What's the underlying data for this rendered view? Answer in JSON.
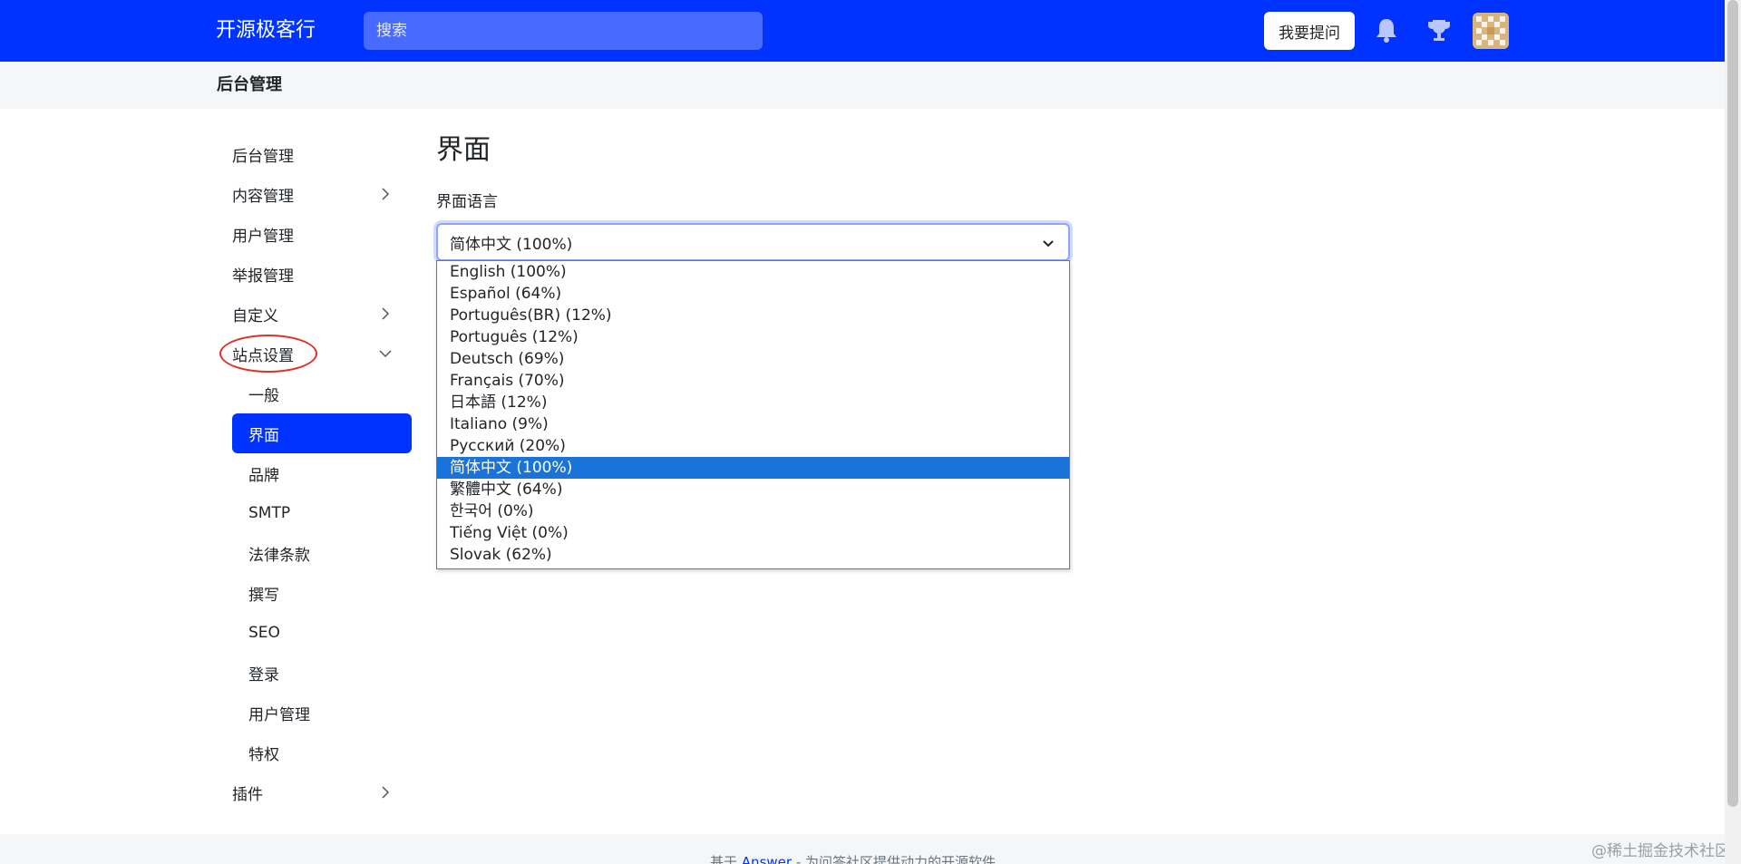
{
  "header": {
    "brand": "开源极客行",
    "search_placeholder": "搜索",
    "ask_button": "我要提问",
    "icons": [
      "bell-icon",
      "trophy-icon",
      "avatar"
    ]
  },
  "subheader": {
    "title": "后台管理"
  },
  "sidebar": {
    "items": [
      {
        "label": "后台管理",
        "level": 0,
        "chevron": "none"
      },
      {
        "label": "内容管理",
        "level": 0,
        "chevron": "right"
      },
      {
        "label": "用户管理",
        "level": 0,
        "chevron": "none"
      },
      {
        "label": "举报管理",
        "level": 0,
        "chevron": "none"
      },
      {
        "label": "自定义",
        "level": 0,
        "chevron": "right"
      },
      {
        "label": "站点设置",
        "level": 0,
        "chevron": "down",
        "circled": true
      },
      {
        "label": "一般",
        "level": 1,
        "chevron": "none"
      },
      {
        "label": "界面",
        "level": 1,
        "chevron": "none",
        "active": true
      },
      {
        "label": "品牌",
        "level": 1,
        "chevron": "none"
      },
      {
        "label": "SMTP",
        "level": 1,
        "chevron": "none"
      },
      {
        "label": "法律条款",
        "level": 1,
        "chevron": "none"
      },
      {
        "label": "撰写",
        "level": 1,
        "chevron": "none"
      },
      {
        "label": "SEO",
        "level": 1,
        "chevron": "none"
      },
      {
        "label": "登录",
        "level": 1,
        "chevron": "none"
      },
      {
        "label": "用户管理",
        "level": 1,
        "chevron": "none"
      },
      {
        "label": "特权",
        "level": 1,
        "chevron": "none"
      },
      {
        "label": "插件",
        "level": 0,
        "chevron": "right"
      }
    ]
  },
  "main": {
    "title": "界面",
    "language_label": "界面语言",
    "selected_language": "简体中文 (100%)",
    "options": [
      "English (100%)",
      "Español (64%)",
      "Português(BR) (12%)",
      "Português (12%)",
      "Deutsch (69%)",
      "Français (70%)",
      "日本語 (12%)",
      "Italiano (9%)",
      "Русский (20%)",
      "简体中文 (100%)",
      "繁體中文 (64%)",
      "한국어 (0%)",
      "Tiếng Việt (0%)",
      "Slovak (62%)"
    ],
    "highlighted_option_index": 9
  },
  "footer": {
    "prefix": "基于",
    "link": "Answer",
    "suffix": "- 为问答社区提供动力的开源软件"
  },
  "watermark": "@稀土掘金技术社区",
  "colors": {
    "primary": "#0033ff",
    "option_highlight": "#1a73d9",
    "circle_mark": "#e0302a"
  }
}
